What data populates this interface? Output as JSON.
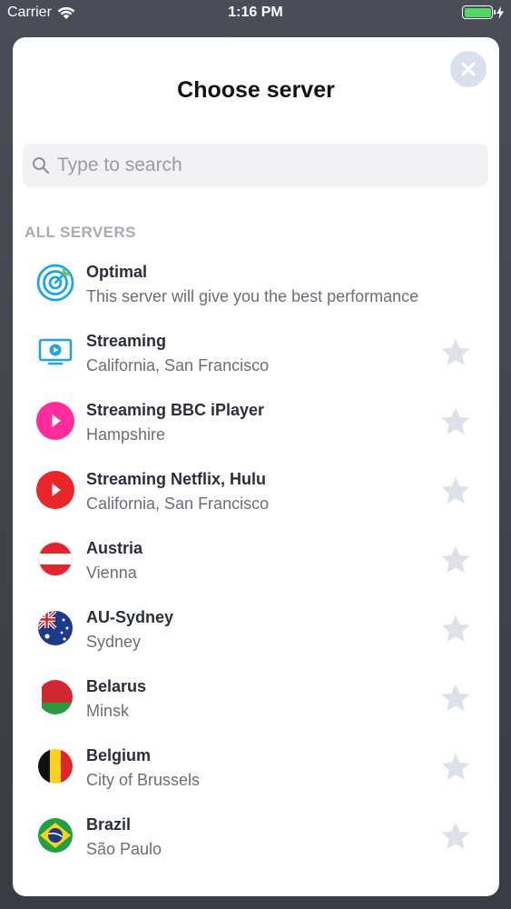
{
  "status_bar": {
    "carrier": "Carrier",
    "time": "1:16 PM",
    "battery_level": 1.0,
    "battery_color": "#4cd964"
  },
  "sheet": {
    "title": "Choose server",
    "close_icon": "close-x-icon",
    "search": {
      "placeholder": "Type to search",
      "value": ""
    },
    "section_header": "ALL SERVERS"
  },
  "servers": [
    {
      "name": "Optimal",
      "subtitle": "This server will give you the best performance",
      "icon": "target-icon",
      "favorite": null
    },
    {
      "name": "Streaming",
      "subtitle": "California, San Francisco",
      "icon": "monitor-play-icon",
      "favorite": false
    },
    {
      "name": "Streaming BBC iPlayer",
      "subtitle": "Hampshire",
      "icon": "pink-play-icon",
      "favorite": false
    },
    {
      "name": "Streaming Netflix, Hulu",
      "subtitle": "California, San Francisco",
      "icon": "red-play-icon",
      "favorite": false
    },
    {
      "name": "Austria",
      "subtitle": "Vienna",
      "icon": "austria-flag-icon",
      "favorite": false
    },
    {
      "name": "AU-Sydney",
      "subtitle": "Sydney",
      "icon": "australia-flag-icon",
      "favorite": false
    },
    {
      "name": "Belarus",
      "subtitle": "Minsk",
      "icon": "belarus-flag-icon",
      "favorite": false
    },
    {
      "name": "Belgium",
      "subtitle": "City of Brussels",
      "icon": "belgium-flag-icon",
      "favorite": false
    },
    {
      "name": "Brazil",
      "subtitle": "São Paulo",
      "icon": "brazil-flag-icon",
      "favorite": false
    }
  ],
  "colors": {
    "star_inactive": "#dde1ea",
    "close_bg": "#d9dfec",
    "accent_blue": "#1fa5e6"
  }
}
